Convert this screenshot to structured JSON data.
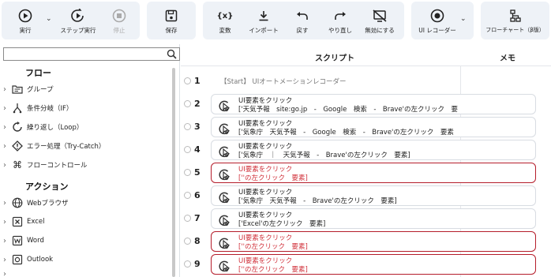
{
  "toolbar": {
    "run": "実行",
    "step_run": "ステップ実行",
    "stop": "停止",
    "save": "保存",
    "variables": "変数",
    "import": "インポート",
    "undo": "戻す",
    "redo": "やり直し",
    "disable": "無効にする",
    "ui_recorder": "UI レコーダー",
    "flowchart": "フローチャート（β版）",
    "variables_icon_text": "{x}"
  },
  "sidebar": {
    "flow_header": "フロー",
    "flow_items": [
      {
        "label": "グループ",
        "icon": "group-icon"
      },
      {
        "label": "条件分岐（IF）",
        "icon": "branch-icon"
      },
      {
        "label": "繰り返し（Loop）",
        "icon": "loop-icon"
      },
      {
        "label": "エラー処理（Try-Catch）",
        "icon": "error-diamond-icon"
      },
      {
        "label": "フローコントロール",
        "icon": "command-icon"
      }
    ],
    "action_header": "アクション",
    "action_items": [
      {
        "label": "Webブラウザ",
        "icon": "globe-icon"
      },
      {
        "label": "Excel",
        "icon": "excel-icon"
      },
      {
        "label": "Word",
        "icon": "word-icon"
      },
      {
        "label": "Outlook",
        "icon": "outlook-icon"
      }
    ]
  },
  "main": {
    "col_script": "スクリプト",
    "col_memo": "メモ",
    "start_row": {
      "num": "1",
      "text": "【Start】 UIオートメーションレコーダー"
    },
    "rows": [
      {
        "num": "2",
        "title": "UI要素をクリック",
        "detail": "['天気予報　site:go.jp　-　Google　検索　-　Brave'の左クリック　要",
        "error": false
      },
      {
        "num": "3",
        "title": "UI要素をクリック",
        "detail": "['気象庁　天気予報　-　Google　検索　-　Brave'の左クリック　要素",
        "error": false
      },
      {
        "num": "4",
        "title": "UI要素をクリック",
        "detail": "['気象庁　｜　天気予報　-　Brave'の左クリック　要素]",
        "error": false
      },
      {
        "num": "5",
        "title": "UI要素をクリック",
        "detail": "[''の左クリック　要素]",
        "error": true
      },
      {
        "num": "6",
        "title": "UI要素をクリック",
        "detail": "['気象庁　天気予報　-　Brave'の左クリック　要素]",
        "error": false
      },
      {
        "num": "7",
        "title": "UI要素をクリック",
        "detail": "['Excel'の左クリック　要素]",
        "error": false
      },
      {
        "num": "8",
        "title": "UI要素をクリック",
        "detail": "[''の左クリック　要素]",
        "error": true
      },
      {
        "num": "9",
        "title": "UI要素をクリック",
        "detail": "[''の左クリック　要素]",
        "error": true
      }
    ]
  },
  "colors": {
    "error": "#d0303a",
    "error_border": "#b51d2b",
    "toolbar_bg": "#eef2f7"
  }
}
